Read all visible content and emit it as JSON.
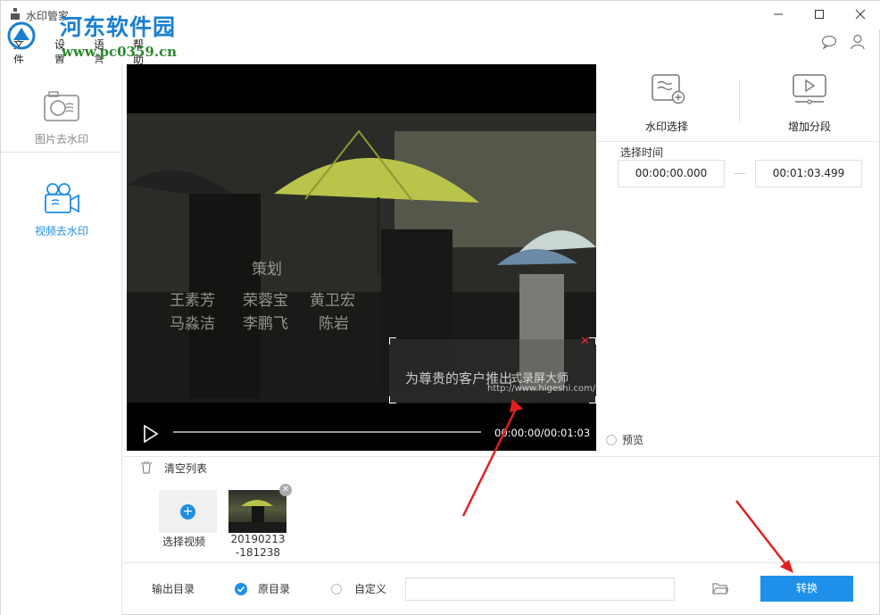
{
  "window": {
    "title": "水印管家"
  },
  "site_watermark": {
    "name": "河东软件园",
    "url": "www.pc0359.cn"
  },
  "menu": {
    "items": [
      "文件",
      "设置",
      "语言",
      "帮助"
    ]
  },
  "top_icons": [
    "chat-icon",
    "user-icon"
  ],
  "sidebar": {
    "items": [
      {
        "label": "图片去水印",
        "icon": "image-camera-icon",
        "active": false
      },
      {
        "label": "视频去水印",
        "icon": "video-camera-icon",
        "active": true
      }
    ]
  },
  "player": {
    "time": "00:00:00/00:01:03",
    "overlay_credits": [
      "策划",
      "王素芳",
      "荣蓉宝",
      "黄卫宏",
      "马淼洁",
      "李鹏飞",
      "陈岩"
    ],
    "watermark_text": "为尊贵的客户推出",
    "watermark_brand": "式录屏大师",
    "watermark_url": "http://www.higeshi.com/"
  },
  "tools": {
    "watermark_select": "水印选择",
    "add_segment": "增加分段"
  },
  "time_select": {
    "label": "选择时间",
    "start": "00:00:00.000",
    "end": "00:01:03.499"
  },
  "preview": {
    "label": "预览"
  },
  "list": {
    "clear_label": "清空列表",
    "add_label": "选择视频",
    "files": [
      {
        "name_line1": "20190213",
        "name_line2": "-181238"
      }
    ]
  },
  "output": {
    "label": "输出目录",
    "original": "原目录",
    "custom": "自定义",
    "path": "",
    "convert_label": "转换"
  },
  "colors": {
    "accent": "#1e90ea",
    "arrow": "#e02020"
  }
}
